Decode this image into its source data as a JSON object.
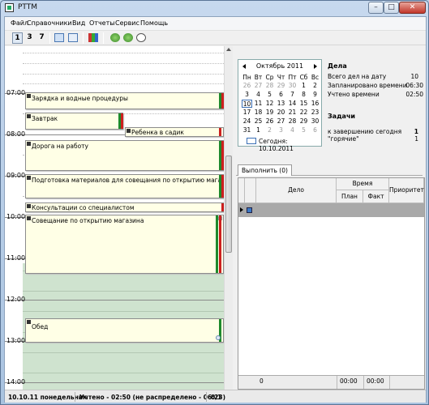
{
  "window": {
    "title": "PTTM"
  },
  "menu": [
    "Файл",
    "Справочники",
    "Вид",
    "Отчеты",
    "Сервис",
    "Помощь"
  ],
  "toolbar": {
    "view_buttons": [
      "1",
      "3",
      "7"
    ]
  },
  "day_view": {
    "hours": [
      "07:00",
      "08:00",
      "09:00",
      "10:00",
      "11:00",
      "12:00",
      "13:00",
      "14:00"
    ],
    "tasks": [
      "Зарядка и водные процедуры",
      "Завтрак",
      "Ребенка в садик",
      "Дорога на работу",
      "Подготовка материалов для совещания по открытию магазина",
      "Консультации со специалистом",
      "Совещание по открытию магазина",
      "Обед"
    ]
  },
  "calendar": {
    "month_label": "Октябрь 2011",
    "dow": [
      "Пн",
      "Вт",
      "Ср",
      "Чт",
      "Пт",
      "Сб",
      "Вс"
    ],
    "days": [
      "26",
      "27",
      "28",
      "29",
      "30",
      "1",
      "2",
      "3",
      "4",
      "5",
      "6",
      "7",
      "8",
      "9",
      "10",
      "11",
      "12",
      "13",
      "14",
      "15",
      "16",
      "17",
      "18",
      "19",
      "20",
      "21",
      "22",
      "23",
      "24",
      "25",
      "26",
      "27",
      "28",
      "29",
      "30",
      "31",
      "1",
      "2",
      "3",
      "4",
      "5",
      "6"
    ],
    "today_label": "Сегодня: 10.10.2011"
  },
  "summary": {
    "deals_title": "Дела",
    "total_label": "Всего дел на дату",
    "total_value": "10",
    "planned_label": "Запланировано времени",
    "planned_value": "06:30",
    "accounted_label": "Учтено времени",
    "accounted_value": "02:50",
    "tasks_title": "Задачи",
    "to_complete_label": "к завершению сегодня",
    "to_complete_value": "1",
    "hot_label": "\"горячие\"",
    "hot_value": "1"
  },
  "tabs": [
    "Выполнить (0)"
  ],
  "grid": {
    "col_deal": "Дело",
    "col_time": "Время",
    "col_plan": "План",
    "col_fact": "Факт",
    "col_priority": "Приоритет",
    "footer_count": "0",
    "footer_plan": "00:00",
    "footer_fact": "00:00"
  },
  "status": {
    "date": "10.10.11 понедельник",
    "accounted": "Учтено - 02:50 (не распределено - 06:23)",
    "page": "0/1"
  }
}
